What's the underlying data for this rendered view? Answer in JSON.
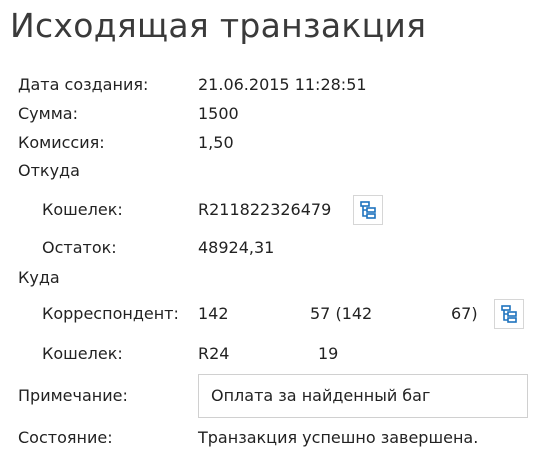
{
  "title": "Исходящая транзакция",
  "fields": {
    "created_label": "Дата создания:",
    "created_value": "21.06.2015 11:28:51",
    "amount_label": "Сумма:",
    "amount_value": "1500",
    "fee_label": "Комиссия:",
    "fee_value": "1,50",
    "from_label": "Откуда",
    "from_wallet_label": "Кошелек:",
    "from_wallet_value": "R211822326479",
    "balance_label": "Остаток:",
    "balance_value": "48924,31",
    "to_label": "Куда",
    "correspondent_label": "Корреспондент:",
    "correspondent_part1": "142",
    "correspondent_part2": "57 (142",
    "correspondent_part3": "67)",
    "to_wallet_label": "Кошелек:",
    "to_wallet_part1": "R24",
    "to_wallet_part2": "19",
    "note_label": "Примечание:",
    "note_value": "Оплата за найденный баг",
    "status_label": "Состояние:",
    "status_value": "Транзакция успешно завершена."
  },
  "icons": {
    "wallet_tree": "hierarchy-icon",
    "correspondent_tree": "hierarchy-icon"
  },
  "colors": {
    "icon_accent": "#1e73be"
  }
}
